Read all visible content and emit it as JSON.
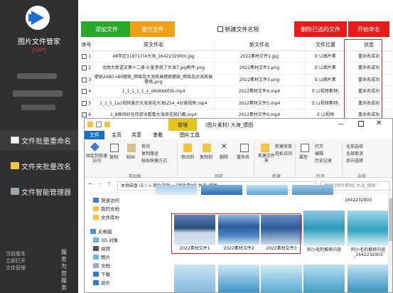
{
  "sidebar": {
    "app_title": "图片文件管家",
    "version": "[VIP]",
    "nav": [
      {
        "label": "文件批量重命名",
        "active": true
      },
      {
        "label": "文件夹批量改名",
        "active": false
      },
      {
        "label": "文件智能管理器",
        "active": false
      }
    ],
    "footer_lines": [
      "当前版本",
      "立即打开",
      "文件管理"
    ],
    "footer_side": "服务为您服务"
  },
  "toolbar": {
    "add_files": "添加文件",
    "clear_list": "清空文件",
    "set_rule": "新建文件名规",
    "rename_selected": "删除已选的文件",
    "start": "开始命名"
  },
  "table": {
    "headers": [
      "序号",
      "原文件名",
      "新文件名",
      "文件位置",
      "状态"
    ],
    "rows": [
      {
        "no": "1",
        "orig": "48年区318717(4大海_1642232900).jpg",
        "new": "2022素材文件1.jpg",
        "loc": "E:\\1图片素",
        "status": "重命名成功"
      },
      {
        "no": "2",
        "orig": "北明大新语文第十二册-9.鉴赏我了大海7.jpg附件.png",
        "new": "2022素材文件2.png",
        "loc": "E:\\1图片素",
        "status": "重命名成功"
      },
      {
        "no": "3",
        "orig": "壁纸2480 x80壁纸_颜瑶岛大海风景壁纸壁纸_颜瑶岛大海风景壁纸.png",
        "new": "2022素材文件3.png",
        "loc": "E:\\1图片素",
        "status": "重命名成功"
      },
      {
        "no": "4",
        "orig": "1_1_1_1_1_1_d4d666f3b.mp4",
        "new": "2022素材文件4.mp4",
        "loc": "E:\\1视频素材\\",
        "status": "重命名成功"
      },
      {
        "no": "5",
        "orig": "1_1_5_1a1视频演示大海浪花大海tZz4_4分类视频.mp4",
        "new": "2022素材文件5.mp4",
        "loc": "E:\\1视频素材\\",
        "status": "重命名成功"
      },
      {
        "no": "6",
        "orig": "1_8映风好在你游泳看看大海浪花我们都.mp4",
        "new": "2022素材文件6.mp4",
        "loc": "E:\\1视频",
        "status": "重命名成功"
      }
    ]
  },
  "explorer": {
    "manage_tab": "管理",
    "title": "(图片素材) 大海_摸图",
    "tabs": [
      "文件",
      "主页",
      "共享",
      "查看",
      "图片工具"
    ],
    "ribbon": {
      "pin": "固定到快速访问",
      "copy": "复制",
      "paste": "粘贴",
      "cut": "剪切",
      "copy_path": "复制路径",
      "paste_shortcut": "粘贴快捷方式",
      "move_to": "移动到",
      "copy_to": "复制到",
      "delete": "删除",
      "rename": "重命名",
      "new_folder": "新建文件夹",
      "new_item": "新建项目",
      "easy_access": "轻松访问",
      "properties": "属性",
      "open": "打开",
      "edit": "编辑",
      "history": "历史记录",
      "select_all": "全部选择",
      "select_none": "全部取消",
      "invert": "反向选择",
      "groups": [
        "剪贴板",
        "组织",
        "新建",
        "打开",
        "选择"
      ]
    },
    "address": "本地磁盘 (E:) > 图片下载 > [图片素材] 大海_摸图",
    "search_placeholder": "搜索\"[图片素材] 大海_摸图\"",
    "tree": [
      "快速访问",
      "我的文档",
      "文件库中",
      "此电脑",
      "3D 对象",
      "视频",
      "图片",
      "文档",
      "下载",
      "音乐"
    ],
    "files": [
      {
        "name": "2022素材文件1",
        "kind": "boat"
      },
      {
        "name": "2022素材文件2",
        "kind": "sea"
      },
      {
        "name": "2022素材文件3",
        "kind": "sea"
      },
      {
        "name": "阿小毛的推荐内容",
        "kind": "wave"
      },
      {
        "name": "阿小毛的推荐内容_1642232903",
        "kind": "wave"
      }
    ],
    "files_top_names": [
      "",
      "",
      "",
      "",
      "1642232903"
    ]
  },
  "colors": {
    "sidebar": "#2f2f2f",
    "green": "#2aa829",
    "orange": "#f0a017",
    "red": "#e81b1b",
    "explorer_blue": "#1a6fc9",
    "manage_yellow": "#e6c51e"
  }
}
